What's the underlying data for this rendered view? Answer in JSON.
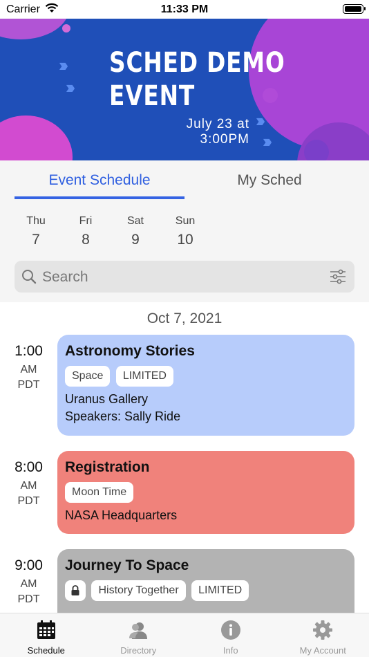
{
  "status_bar": {
    "carrier": "Carrier",
    "time": "11:33 PM"
  },
  "banner": {
    "title_line1": "SCHED DEMO",
    "title_line2": "EVENT",
    "date_line1": "July 23 at",
    "date_line2": "3:00PM"
  },
  "tabs": {
    "event_schedule": "Event Schedule",
    "my_sched": "My Sched",
    "active": "event_schedule"
  },
  "days": [
    {
      "name": "Thu",
      "num": "7"
    },
    {
      "name": "Fri",
      "num": "8"
    },
    {
      "name": "Sat",
      "num": "9"
    },
    {
      "name": "Sun",
      "num": "10"
    }
  ],
  "search": {
    "placeholder": "Search"
  },
  "date_header": "Oct 7, 2021",
  "sessions": [
    {
      "time": "1:00",
      "ampm": "AM",
      "tz": "PDT",
      "title": "Astronomy Stories",
      "tags": [
        "Space",
        "LIMITED"
      ],
      "venue": "Uranus Gallery",
      "speakers": "Speakers: Sally Ride",
      "color": "#b7ccfb"
    },
    {
      "time": "8:00",
      "ampm": "AM",
      "tz": "PDT",
      "title": "Registration",
      "tags": [
        "Moon Time"
      ],
      "venue": "NASA Headquarters",
      "color": "#f0827b"
    },
    {
      "time": "9:00",
      "ampm": "AM",
      "tz": "PDT",
      "title": "Journey To Space",
      "locked": true,
      "tags": [
        "History Together",
        "LIMITED"
      ],
      "color": "#b3b3b3"
    }
  ],
  "tabbar": [
    {
      "label": "Schedule",
      "icon": "calendar-icon",
      "active": true
    },
    {
      "label": "Directory",
      "icon": "person-icon"
    },
    {
      "label": "Info",
      "icon": "info-icon"
    },
    {
      "label": "My Account",
      "icon": "gear-icon"
    }
  ],
  "colors": {
    "accent": "#3563e3",
    "banner": "#1f4fb8"
  }
}
